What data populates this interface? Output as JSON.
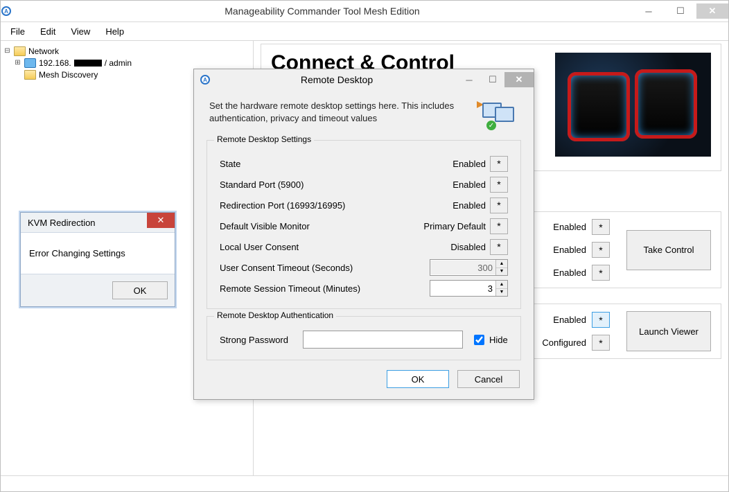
{
  "app": {
    "title": "Manageability Commander Tool Mesh Edition"
  },
  "menu": {
    "file": "File",
    "edit": "Edit",
    "view": "View",
    "help": "Help"
  },
  "tree": {
    "network": "Network",
    "host_ip": "192.168.",
    "host_suffix": "/ admin",
    "mesh": "Mesh Discovery"
  },
  "hero": {
    "title": "Connect & Control"
  },
  "side_panel1": {
    "r1": "Enabled",
    "r2": "Enabled",
    "r3": "Enabled",
    "button": "Take Control"
  },
  "side_panel2": {
    "r1": "Enabled",
    "r2": "Configured",
    "button": "Launch Viewer"
  },
  "error_dialog": {
    "title": "KVM Redirection",
    "message": "Error Changing Settings",
    "ok": "OK"
  },
  "rd_dialog": {
    "title": "Remote Desktop",
    "desc": "Set the hardware remote desktop settings here. This includes authentication, privacy and timeout values",
    "group1_title": "Remote Desktop Settings",
    "state_label": "State",
    "state_val": "Enabled",
    "stdport_label": "Standard Port (5900)",
    "stdport_val": "Enabled",
    "redir_label": "Redirection Port (16993/16995)",
    "redir_val": "Enabled",
    "monitor_label": "Default Visible Monitor",
    "monitor_val": "Primary Default",
    "consent_label": "Local User Consent",
    "consent_val": "Disabled",
    "consent_to_label": "User Consent Timeout (Seconds)",
    "consent_to_val": "300",
    "session_to_label": "Remote Session Timeout (Minutes)",
    "session_to_val": "3",
    "group2_title": "Remote Desktop Authentication",
    "pwd_label": "Strong Password",
    "hide_label": "Hide",
    "ok": "OK",
    "cancel": "Cancel"
  }
}
